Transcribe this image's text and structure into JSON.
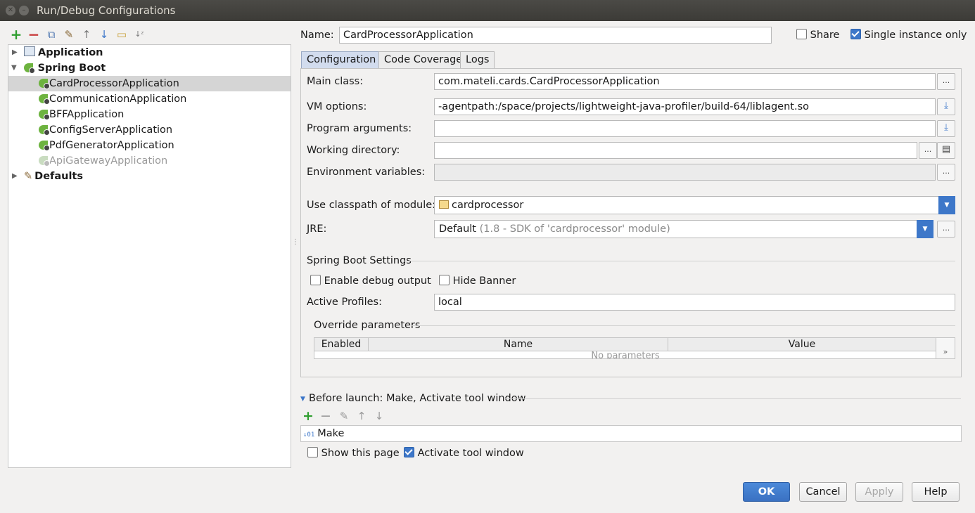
{
  "window": {
    "title": "Run/Debug Configurations"
  },
  "tree": {
    "groups": [
      {
        "label": "Application"
      },
      {
        "label": "Spring Boot"
      },
      {
        "label": "Defaults"
      }
    ],
    "spring_boot_items": [
      {
        "label": "CardProcessorApplication"
      },
      {
        "label": "CommunicationApplication"
      },
      {
        "label": "BFFApplication"
      },
      {
        "label": "ConfigServerApplication"
      },
      {
        "label": "PdfGeneratorApplication"
      },
      {
        "label": "ApiGatewayApplication"
      }
    ]
  },
  "header": {
    "name_label": "Name:",
    "name_value": "CardProcessorApplication",
    "share_label": "Share",
    "share_checked": false,
    "single_instance_label": "Single instance only",
    "single_instance_checked": true
  },
  "tabs": [
    {
      "label": "Configuration"
    },
    {
      "label": "Code Coverage"
    },
    {
      "label": "Logs"
    }
  ],
  "config": {
    "main_class_label": "Main class:",
    "main_class_value": "com.mateli.cards.CardProcessorApplication",
    "vm_options_label": "VM options:",
    "vm_options_value": "-agentpath:/space/projects/lightweight-java-profiler/build-64/liblagent.so",
    "program_args_label": "Program arguments:",
    "program_args_value": "",
    "working_dir_label": "Working directory:",
    "working_dir_value": "",
    "env_vars_label": "Environment variables:",
    "env_vars_value": "",
    "classpath_label": "Use classpath of module:",
    "classpath_value": "cardprocessor",
    "jre_label": "JRE:",
    "jre_value": "Default",
    "jre_detail": "(1.8 - SDK of 'cardprocessor' module)",
    "browse_label": "..."
  },
  "spring_boot_settings": {
    "title": "Spring Boot Settings",
    "debug_output_label": "Enable debug output",
    "hide_banner_label": "Hide Banner",
    "active_profiles_label": "Active Profiles:",
    "active_profiles_value": "local",
    "override_title": "Override parameters",
    "columns": [
      "Enabled",
      "Name",
      "Value"
    ],
    "empty_text": "No parameters",
    "more_label": "»"
  },
  "before_launch": {
    "title": "Before launch: Make, Activate tool window",
    "items": [
      {
        "label": "Make"
      }
    ],
    "show_page_label": "Show this page",
    "show_page_checked": false,
    "activate_label": "Activate tool window",
    "activate_checked": true
  },
  "buttons": {
    "ok": "OK",
    "cancel": "Cancel",
    "apply": "Apply",
    "help": "Help"
  },
  "colors": {
    "accent": "#3d77c9",
    "spring_green": "#6db33f",
    "selection": "#d5d5d5"
  }
}
